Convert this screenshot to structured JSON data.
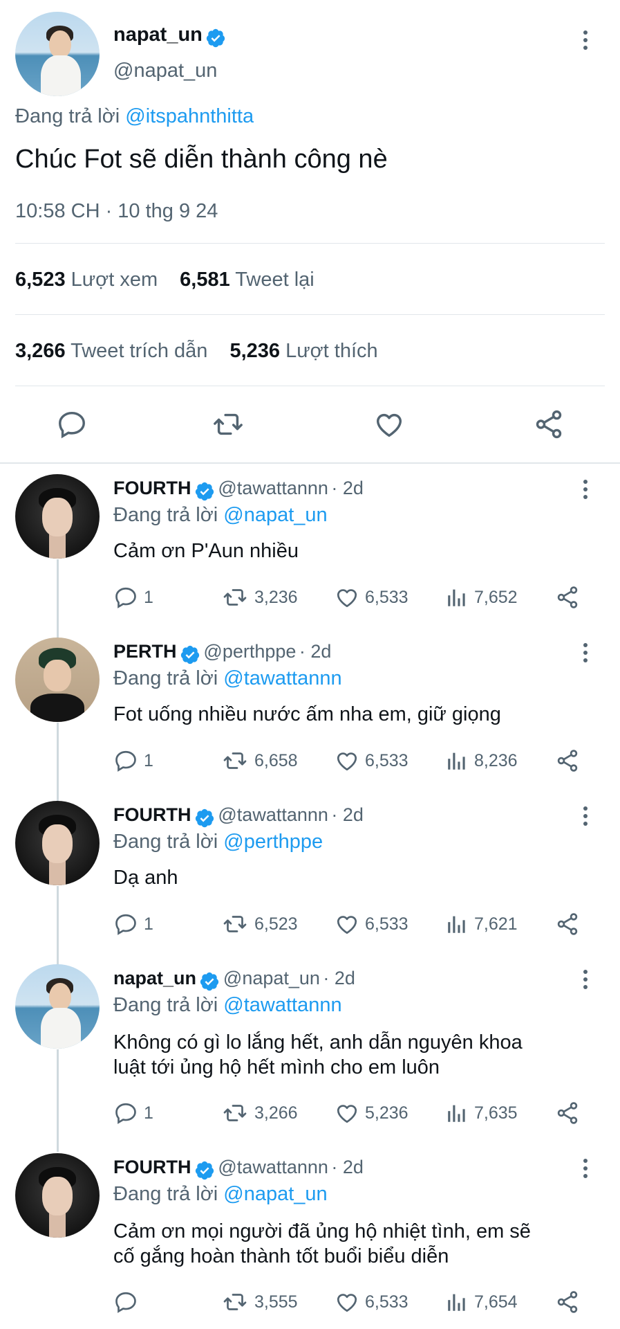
{
  "main": {
    "display_name": "napat_un",
    "handle": "@napat_un",
    "reply_label": "Đang trả lời",
    "reply_to": "@itspahnthitta",
    "text": "Chúc Fot sẽ diễn thành công nè",
    "timestamp": "10:58 CH · 10 thg 9 24",
    "stats": {
      "views_count": "6,523",
      "views_label": "Lượt xem",
      "retweets_count": "6,581",
      "retweets_label": "Tweet lại",
      "quotes_count": "3,266",
      "quotes_label": "Tweet trích dẫn",
      "likes_count": "5,236",
      "likes_label": "Lượt thích"
    }
  },
  "replies": [
    {
      "name": "FOURTH",
      "handle": "@tawattannn",
      "time": "· 2d",
      "reply_label": "Đang trả lời",
      "reply_to": "@napat_un",
      "text": "Cảm ơn P'Aun nhiều",
      "reply_count": "1",
      "retweets": "3,236",
      "likes": "6,533",
      "views": "7,652"
    },
    {
      "name": "PERTH",
      "handle": "@perthppe",
      "time": "· 2d",
      "reply_label": "Đang trả lời",
      "reply_to": "@tawattannn",
      "text": "Fot uống nhiều nước ấm nha em, giữ giọng",
      "reply_count": "1",
      "retweets": "6,658",
      "likes": "6,533",
      "views": "8,236"
    },
    {
      "name": "FOURTH",
      "handle": "@tawattannn",
      "time": "· 2d",
      "reply_label": "Đang trả lời",
      "reply_to": "@perthppe",
      "text": "Dạ anh",
      "reply_count": "1",
      "retweets": "6,523",
      "likes": "6,533",
      "views": "7,621"
    },
    {
      "name": "napat_un",
      "handle": "@napat_un",
      "time": "· 2d",
      "reply_label": "Đang trả lời",
      "reply_to": "@tawattannn",
      "text_line1": "Không có gì lo lắng hết, anh dẫn nguyên khoa",
      "text_line2": "luật tới ủng hộ hết mình cho em luôn",
      "reply_count": "1",
      "retweets": "3,266",
      "likes": "5,236",
      "views": "7,635"
    },
    {
      "name": "FOURTH",
      "handle": "@tawattannn",
      "time": "· 2d",
      "reply_label": "Đang trả lời",
      "reply_to": "@napat_un",
      "text_line1": "Cảm ơn mọi người đã ủng hộ nhiệt tình, em sẽ",
      "text_line2": "cố gắng hoàn thành tốt buổi biểu diễn",
      "reply_count": "",
      "retweets": "3,555",
      "likes": "6,533",
      "views": "7,654"
    }
  ],
  "colors": {
    "accent": "#1d9bf0",
    "muted": "#536471",
    "divider": "#e1e6ea"
  }
}
